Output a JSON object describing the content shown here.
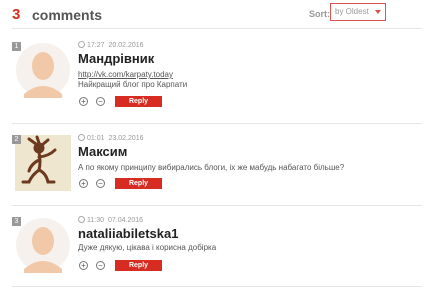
{
  "header": {
    "count": "3",
    "count_label": "comments",
    "sort_label": "Sort:",
    "sort_value": "by Oldest"
  },
  "comments": [
    {
      "number": "1",
      "time": "17:27",
      "date": "20.02.2016",
      "author": "Мандрівник",
      "link": "http://vk.com/karpaty.today",
      "text": "Найкращий блог про Карпати",
      "reply_label": "Reply",
      "upvote_symbol": "+",
      "downvote_symbol": "−"
    },
    {
      "number": "2",
      "time": "01:01",
      "date": "23.02.2016",
      "author": "Максим",
      "text": "А по якому принципу вибирались блоги, іх же мабудь набагато більше?",
      "reply_label": "Reply",
      "upvote_symbol": "+",
      "downvote_symbol": "−"
    },
    {
      "number": "3",
      "time": "11:30",
      "date": "07.04.2016",
      "author": "nataliiabiletska1",
      "text": "Дуже дякую, цікава і корисна добірка",
      "reply_label": "Reply",
      "upvote_symbol": "+",
      "downvote_symbol": "−"
    }
  ]
}
